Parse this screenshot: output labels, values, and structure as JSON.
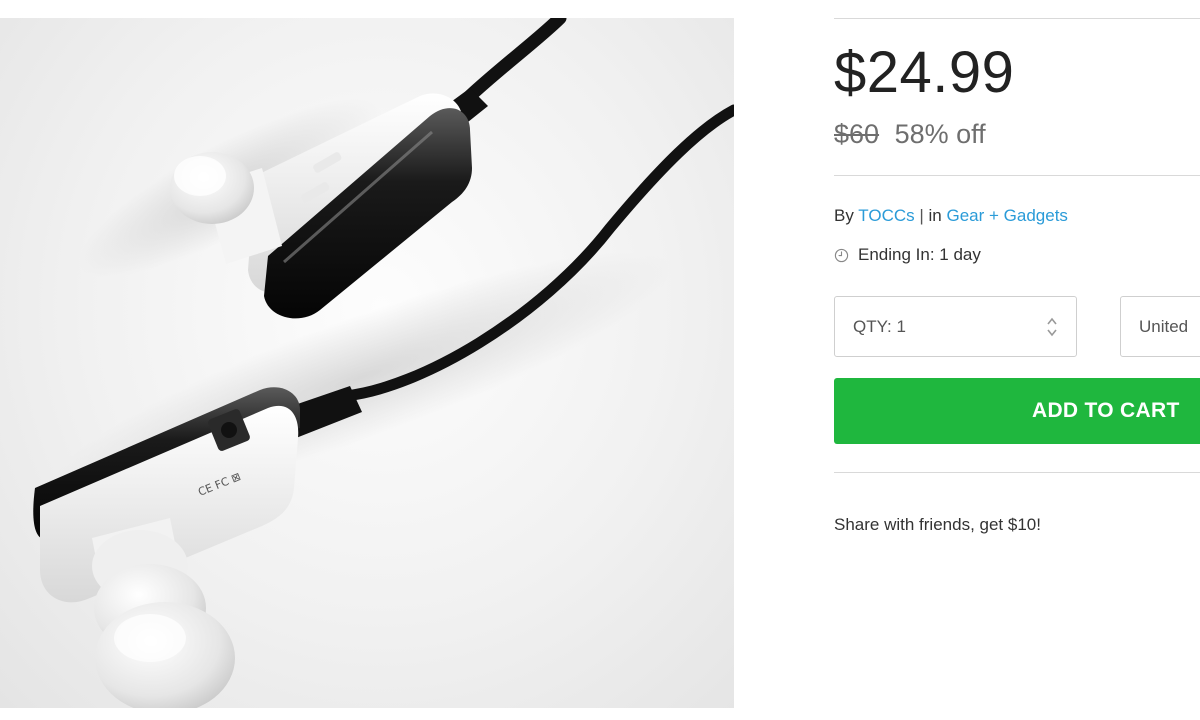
{
  "product_image": {
    "icon": "bluetooth-earbuds-photo"
  },
  "pricing": {
    "price": "$24.99",
    "original_price": "$60",
    "discount": "58% off"
  },
  "meta": {
    "by_label": "By",
    "vendor": "TOCCs",
    "separator": "|",
    "in_label": "in",
    "category": "Gear + Gadgets",
    "link_color": "#2a9bd8"
  },
  "ending": {
    "icon": "clock-icon",
    "text": "Ending In: 1 day"
  },
  "purchase": {
    "qty_label": "QTY: 1",
    "country_label": "United",
    "add_to_cart_label": "ADD TO CART",
    "button_color": "#1fb73e"
  },
  "share": {
    "text": "Share with friends, get $10!"
  }
}
